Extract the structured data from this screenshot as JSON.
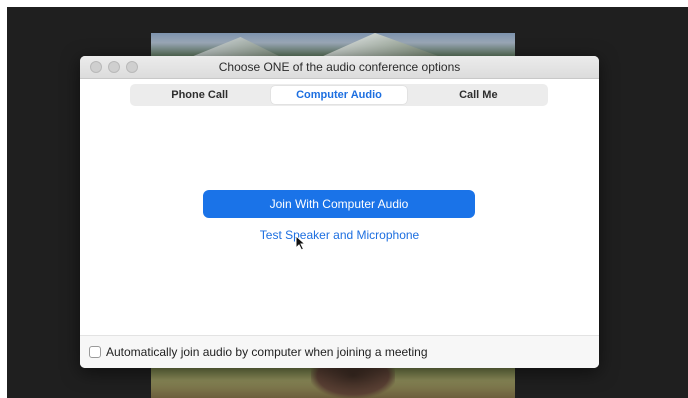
{
  "window": {
    "title": "Choose ONE of the audio conference options"
  },
  "tabs": [
    {
      "label": "Phone Call",
      "active": false
    },
    {
      "label": "Computer Audio",
      "active": true
    },
    {
      "label": "Call Me",
      "active": false
    }
  ],
  "actions": {
    "join_label": "Join With Computer Audio",
    "test_label": "Test Speaker and Microphone"
  },
  "footer": {
    "auto_join_label": "Automatically join audio by computer when joining a meeting",
    "auto_join_checked": false
  },
  "colors": {
    "accent": "#1a73e8",
    "link": "#1d6fe0"
  },
  "icons": [
    "mouse-cursor-icon"
  ]
}
